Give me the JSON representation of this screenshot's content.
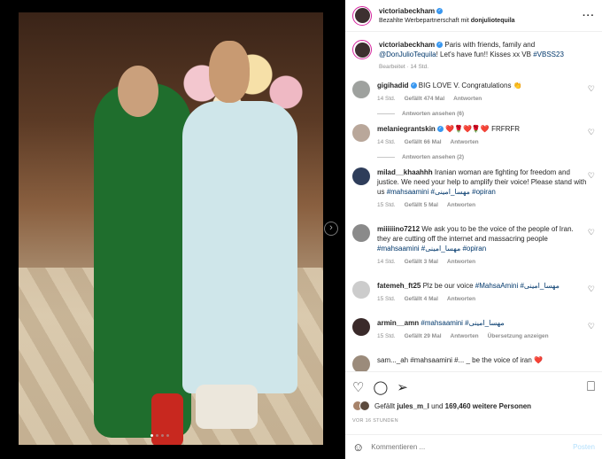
{
  "media": {
    "next": "›",
    "dots": [
      true,
      false,
      false,
      false
    ]
  },
  "header": {
    "username": "victoriabeckham",
    "verified": "✓",
    "paid_prefix": "Bezahlte Werbepartnerschaft mit",
    "partner": "donjuliotequila",
    "more": "···"
  },
  "caption": {
    "username": "victoriabeckham",
    "text_1": "Paris with friends, family and",
    "mention": "@DonJulioTequila",
    "text_2": "! Let's have fun!! Kisses xx VB",
    "hashtag": "#VBSS23",
    "edited": "Bearbeitet · 14 Std."
  },
  "comments": [
    {
      "user": "gigihadid",
      "text": "BIG LOVE V. Congratulations 👏",
      "time": "14 Std.",
      "likes": "Gefällt 474 Mal",
      "reply": "Antworten",
      "avatar": "#9ea19e",
      "replies": "Antworten ansehen (6)"
    },
    {
      "user": "melaniegrantskin",
      "text": "❤️🌹❤️🌹❤️ FRFRFR",
      "time": "14 Std.",
      "likes": "Gefällt 66 Mal",
      "reply": "Antworten",
      "avatar": "#b9a79a",
      "replies": "Antworten ansehen (2)"
    },
    {
      "user": "milad__khaahhh",
      "text": "Iranian woman are fighting for freedom and justice. We need your help to amplify their voice! Please stand with us",
      "tags": "#mahsaamini #مهسا_امینی #opiran",
      "time": "15 Std.",
      "likes": "Gefällt 5 Mal",
      "reply": "Antworten",
      "avatar": "#2e3d5a"
    },
    {
      "user": "miiiiiino7212",
      "text": "We ask you to be the voice of the people of Iran. they are cutting off the internet and massacring people",
      "tags": "#mahsaamini #مهسا_امینی #opiran",
      "time": "14 Std.",
      "likes": "Gefällt 3 Mal",
      "reply": "Antworten",
      "avatar": "#8a8a8a"
    },
    {
      "user": "fatemeh_ft25",
      "text": "Plz be our voice",
      "tags": "#MahsaAmini #مهسا_امینی",
      "time": "15 Std.",
      "likes": "Gefällt 4 Mal",
      "reply": "Antworten",
      "avatar": "#cccccc"
    },
    {
      "user": "armin__amn",
      "text": "",
      "tags": "#mahsaamini #مهسا_امینی",
      "time": "15 Std.",
      "likes": "Gefällt 29 Mal",
      "reply": "Antworten",
      "translate": "Übersetzung anzeigen",
      "avatar": "#3a2a2a"
    }
  ],
  "peek": {
    "text": "sam..._ah #mahsaamini #... _ be the voice of iran ❤️"
  },
  "actions": {
    "like": "♡",
    "comment": "◯",
    "share": "➢",
    "save": "⎕"
  },
  "likes": {
    "prefix": "Gefällt",
    "user": "jules_m_l",
    "mid": "und",
    "count": "169,460 weitere Personen"
  },
  "date": "VOR 16 STUNDEN",
  "add_comment": {
    "emoji": "☺",
    "placeholder": "Kommentieren ...",
    "post": "Posten"
  },
  "colors": {
    "link": "#00376b",
    "verified": "#3897f0",
    "post": "#b2dffc"
  }
}
